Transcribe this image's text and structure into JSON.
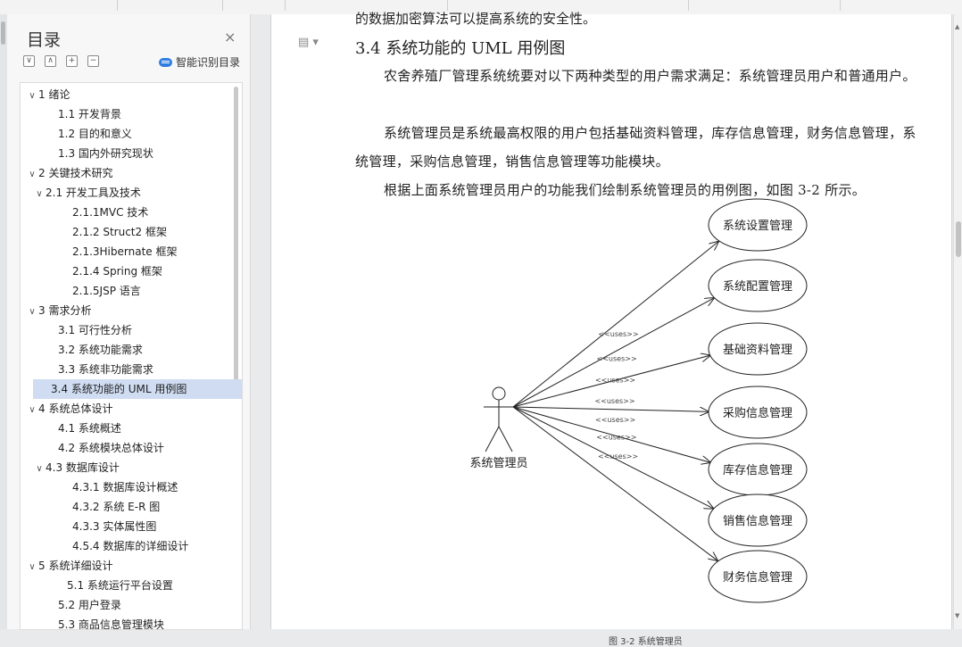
{
  "toc": {
    "title": "目录",
    "close_glyph": "×",
    "controls": [
      "∨",
      "∧",
      "+",
      "−"
    ],
    "smart_label": "智能识别目录",
    "items": [
      {
        "label": "1  绪论",
        "level": 0,
        "chev": "∨",
        "active": false
      },
      {
        "label": "1.1 开发背景",
        "level": 1,
        "chev": "",
        "active": false
      },
      {
        "label": "1.2 目的和意义",
        "level": 1,
        "chev": "",
        "active": false
      },
      {
        "label": "1.3  国内外研究现状",
        "level": 1,
        "chev": "",
        "active": false
      },
      {
        "label": "2 关键技术研究",
        "level": 0,
        "chev": "∨",
        "active": false
      },
      {
        "label": "2.1 开发工具及技术",
        "level": 1,
        "chev": "∨",
        "active": false
      },
      {
        "label": "2.1.1MVC 技术",
        "level": 2,
        "chev": "",
        "active": false
      },
      {
        "label": "2.1.2 Struct2 框架",
        "level": 2,
        "chev": "",
        "active": false
      },
      {
        "label": "2.1.3Hibernate 框架",
        "level": 2,
        "chev": "",
        "active": false
      },
      {
        "label": "2.1.4 Spring 框架",
        "level": 2,
        "chev": "",
        "active": false
      },
      {
        "label": "2.1.5JSP 语言",
        "level": 2,
        "chev": "",
        "active": false
      },
      {
        "label": "3  需求分析",
        "level": 0,
        "chev": "∨",
        "active": false
      },
      {
        "label": "3.1 可行性分析",
        "level": 1,
        "chev": "",
        "active": false
      },
      {
        "label": "3.2 系统功能需求",
        "level": 1,
        "chev": "",
        "active": false
      },
      {
        "label": "3.3 系统非功能需求",
        "level": 1,
        "chev": "",
        "active": false
      },
      {
        "label": "3.4  系统功能的 UML 用例图",
        "level": 1,
        "chev": "",
        "active": true
      },
      {
        "label": "4  系统总体设计",
        "level": 0,
        "chev": "∨",
        "active": false
      },
      {
        "label": "4.1  系统概述",
        "level": 1,
        "chev": "",
        "active": false
      },
      {
        "label": "4.2 系统模块总体设计",
        "level": 1,
        "chev": "",
        "active": false
      },
      {
        "label": "4.3 数据库设计",
        "level": 1,
        "chev": "∨",
        "active": false
      },
      {
        "label": "4.3.1 数据库设计概述",
        "level": 2,
        "chev": "",
        "active": false
      },
      {
        "label": "4.3.2 系统 E-R 图",
        "level": 2,
        "chev": "",
        "active": false
      },
      {
        "label": "4.3.3  实体属性图",
        "level": 2,
        "chev": "",
        "active": false
      },
      {
        "label": "4.5.4 数据库的详细设计",
        "level": 2,
        "chev": "",
        "active": false
      },
      {
        "label": "5  系统详细设计",
        "level": 0,
        "chev": "∨",
        "active": false
      },
      {
        "label": "5.1 系统运行平台设置",
        "level": 1.5,
        "chev": "",
        "active": false
      },
      {
        "label": "5.2 用户登录",
        "level": 1,
        "chev": "",
        "active": false
      },
      {
        "label": "5.3 商品信息管理模块",
        "level": 1,
        "chev": "",
        "active": false
      }
    ]
  },
  "doc": {
    "cut_top_line": "的数据加密算法可以提高系统的安全性。",
    "heading": "3.4  系统功能的 UML 用例图",
    "paragraphs": [
      "农舍养殖厂管理系统统要对以下两种类型的用户需求满足：系统管理员用户和普通用户。",
      "系统管理员是系统最高权限的用户包括基础资料管理，库存信息管理，财务信息管理，系统管理，采购信息管理，销售信息管理等功能模块。",
      "根据上面系统管理员用户的功能我们绘制系统管理员的用例图，如图 3-2 所示。"
    ],
    "diagram": {
      "actor": "系统管理员",
      "relation_label": "<<uses>>",
      "use_cases": [
        "系统设置管理",
        "系统配置管理",
        "基础资料管理",
        "采购信息管理",
        "库存信息管理",
        "销售信息管理",
        "财务信息管理"
      ]
    },
    "bottom_cut": "图 3-2  系统管理员"
  },
  "colors": {
    "active_item": "#cfdcf1",
    "accent": "#2f7de1"
  },
  "icons": [
    "close-icon",
    "collapse-all-icon",
    "expand-all-icon",
    "add-level-icon",
    "remove-level-icon",
    "cloud-icon",
    "page-menu-icon"
  ]
}
